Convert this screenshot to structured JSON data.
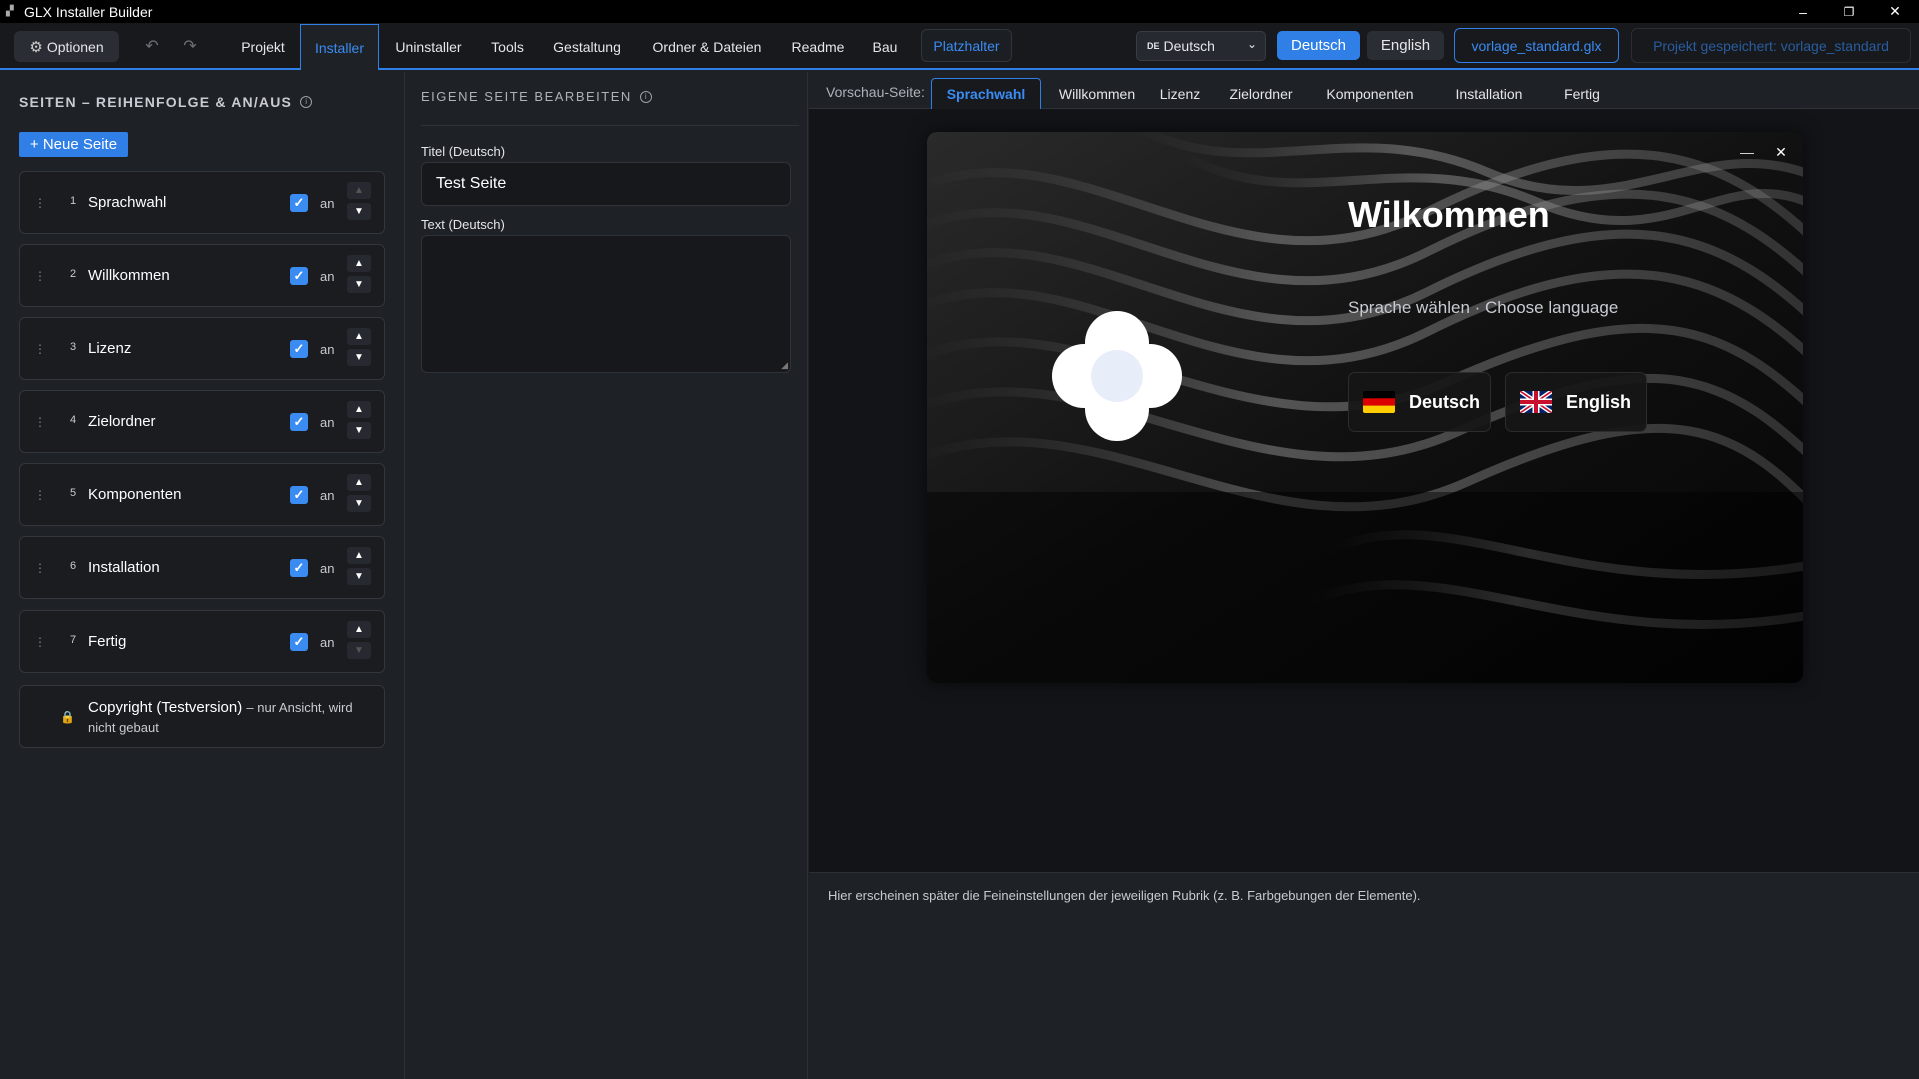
{
  "window": {
    "title": "GLX Installer Builder",
    "controls": {
      "minimize": "–",
      "maximize": "❐",
      "close": "✕"
    }
  },
  "toolbar": {
    "options_label": "Optionen",
    "undo_icon": "↶",
    "redo_icon": "↷",
    "tabs": [
      "Projekt",
      "Installer",
      "Uninstaller",
      "Tools",
      "Gestaltung",
      "Ordner & Dateien",
      "Readme",
      "Bau"
    ],
    "active_tab": "Installer",
    "placeholder_label": "Platzhalter",
    "language_select": {
      "code": "DE",
      "value": "Deutsch"
    },
    "lang_de": "Deutsch",
    "lang_en": "English",
    "file_label": "vorlage_standard.glx",
    "saved_label": "Projekt gespeichert: vorlage_standard",
    "accent_color": "#2f7fe6"
  },
  "left": {
    "heading": "SEITEN – REIHENFOLGE & AN/AUS",
    "info_icon": "i",
    "new_page_label": "+ Neue Seite",
    "pages": [
      {
        "num": "1",
        "label": "Sprachwahl",
        "checked": true,
        "state": "an"
      },
      {
        "num": "2",
        "label": "Willkommen",
        "checked": true,
        "state": "an"
      },
      {
        "num": "3",
        "label": "Lizenz",
        "checked": true,
        "state": "an"
      },
      {
        "num": "4",
        "label": "Zielordner",
        "checked": true,
        "state": "an"
      },
      {
        "num": "5",
        "label": "Komponenten",
        "checked": true,
        "state": "an"
      },
      {
        "num": "6",
        "label": "Installation",
        "checked": true,
        "state": "an"
      },
      {
        "num": "7",
        "label": "Fertig",
        "checked": true,
        "state": "an"
      }
    ],
    "copyright": {
      "title": "Copyright (Testversion)",
      "note": "– nur Ansicht, wird nicht gebaut"
    }
  },
  "middle": {
    "heading": "EIGENE SEITE BEARBEITEN",
    "title_label": "Titel (Deutsch)",
    "title_value": "Test Seite",
    "text_label": "Text (Deutsch)",
    "text_value": ""
  },
  "preview": {
    "label": "Vorschau-Seite:",
    "tabs": [
      "Sprachwahl",
      "Willkommen",
      "Lizenz",
      "Zielordner",
      "Komponenten",
      "Installation",
      "Fertig"
    ],
    "active_tab": "Sprachwahl",
    "window": {
      "heading": "Wilkommen",
      "subtitle": "Sprache wählen · Choose language",
      "lang_de": "Deutsch",
      "lang_en": "English",
      "minimize": "—",
      "close": "✕"
    },
    "bottom_note": "Hier erscheinen später die Feineinstellungen der jeweiligen Rubrik (z. B. Farbgebungen der Elemente)."
  }
}
